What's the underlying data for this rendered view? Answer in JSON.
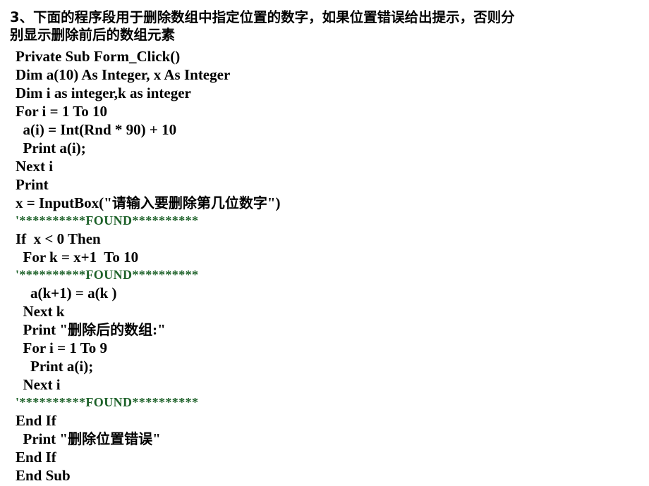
{
  "page": {
    "background_color": "#ffffff",
    "text_color": "#000000",
    "found_marker_color": "#1d6129"
  },
  "question": {
    "number": "3",
    "lines": [
      "3、下面的程序段用于删除数组中指定位置的数字，如果位置错误给出提示，否则分",
      "别显示删除前后的数组元素"
    ]
  },
  "code": {
    "language": "Visual Basic",
    "found_marker": "'**********FOUND**********",
    "lines": [
      {
        "text": "Private Sub Form_Click()",
        "indent": 0,
        "kind": "code"
      },
      {
        "text": "Dim a(10) As Integer, x As Integer",
        "indent": 0,
        "kind": "code"
      },
      {
        "text": "Dim i as integer,k as integer",
        "indent": 0,
        "kind": "code"
      },
      {
        "text": "For i = 1 To 10",
        "indent": 0,
        "kind": "code"
      },
      {
        "text": "  a(i) = Int(Rnd * 90) + 10",
        "indent": 1,
        "kind": "code"
      },
      {
        "text": "  Print a(i);",
        "indent": 1,
        "kind": "code"
      },
      {
        "text": "Next i",
        "indent": 0,
        "kind": "code"
      },
      {
        "text": "Print",
        "indent": 0,
        "kind": "code"
      },
      {
        "text": "x = InputBox(\"请输入要删除第几位数字\")",
        "indent": 0,
        "kind": "code"
      },
      {
        "text": "'**********FOUND**********",
        "indent": 0,
        "kind": "found"
      },
      {
        "text": "If  x < 0 Then",
        "indent": 0,
        "kind": "code"
      },
      {
        "text": "  For k = x+1  To 10",
        "indent": 1,
        "kind": "code"
      },
      {
        "text": "'**********FOUND**********",
        "indent": 0,
        "kind": "found"
      },
      {
        "text": "    a(k+1) = a(k )",
        "indent": 2,
        "kind": "code"
      },
      {
        "text": "  Next k",
        "indent": 1,
        "kind": "code"
      },
      {
        "text": "  Print \"删除后的数组:\"",
        "indent": 1,
        "kind": "code"
      },
      {
        "text": "  For i = 1 To 9",
        "indent": 1,
        "kind": "code"
      },
      {
        "text": "    Print a(i);",
        "indent": 2,
        "kind": "code"
      },
      {
        "text": "  Next i",
        "indent": 1,
        "kind": "code"
      },
      {
        "text": "'**********FOUND**********",
        "indent": 0,
        "kind": "found"
      },
      {
        "text": "End If",
        "indent": 0,
        "kind": "code"
      },
      {
        "text": "  Print \"删除位置错误\"",
        "indent": 1,
        "kind": "code"
      },
      {
        "text": "End If",
        "indent": 0,
        "kind": "code"
      },
      {
        "text": "End Sub",
        "indent": 0,
        "kind": "code"
      }
    ]
  }
}
